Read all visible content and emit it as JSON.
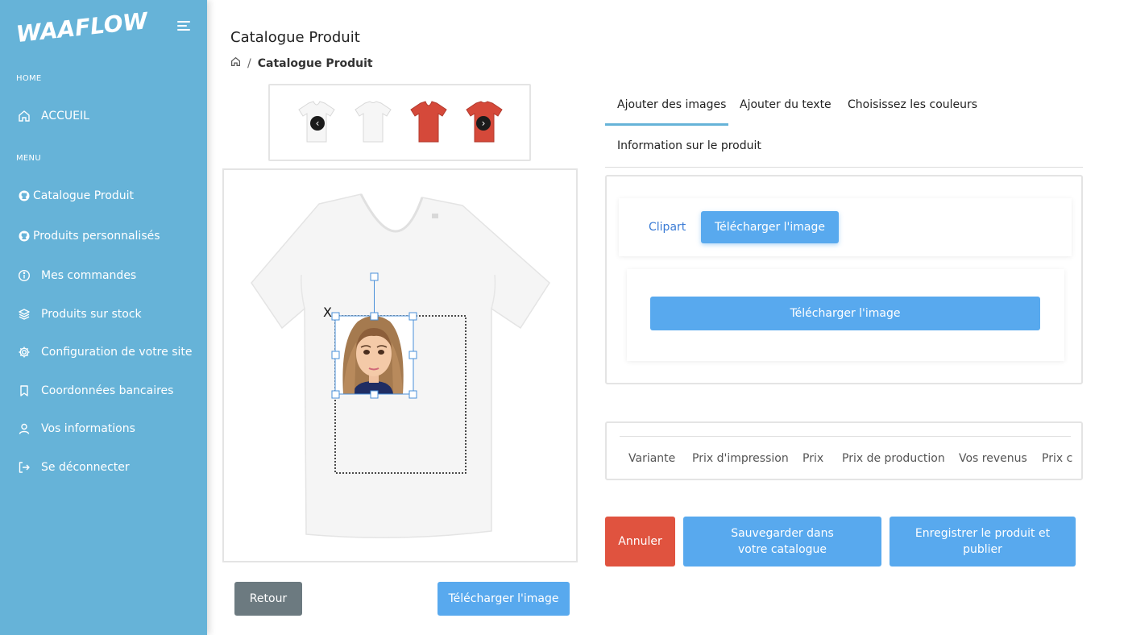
{
  "sidebar": {
    "logo_text": "WAAFLOW!",
    "home_section": "HOME",
    "menu_section": "MENU",
    "items": [
      {
        "label": "ACCUEIL",
        "icon": "home-icon"
      },
      {
        "label": "Catalogue Produit",
        "icon": "github-icon"
      },
      {
        "label": "Produits personnalisés",
        "icon": "github-icon"
      },
      {
        "label": "Mes commandes",
        "icon": "info-icon"
      },
      {
        "label": "Produits sur stock",
        "icon": "layers-icon"
      },
      {
        "label": "Configuration de votre site",
        "icon": "gear-icon"
      },
      {
        "label": "Coordonnées bancaires",
        "icon": "bookmark-icon"
      },
      {
        "label": "Vos informations",
        "icon": "user-icon"
      },
      {
        "label": "Se déconnecter",
        "icon": "logout-icon"
      }
    ]
  },
  "page": {
    "title": "Catalogue Produit",
    "breadcrumb_sep": "/",
    "breadcrumb_current": "Catalogue Produit"
  },
  "editor": {
    "delete_mark": "X",
    "back_label": "Retour",
    "upload_label": "Télécharger l'image"
  },
  "tabs": [
    {
      "label": "Ajouter des images",
      "active": true
    },
    {
      "label": "Ajouter du texte",
      "active": false
    },
    {
      "label": "Choisissez les couleurs",
      "active": false
    },
    {
      "label": "Information sur le produit",
      "active": false
    }
  ],
  "image_panel": {
    "clipart_label": "Clipart",
    "upload_tab_label": "Télécharger l'image",
    "upload_button_label": "Télécharger l'image"
  },
  "table": {
    "headers": [
      "Variante",
      "Prix d'impression",
      "Prix",
      "Prix de production",
      "Vos revenus",
      "Prix c"
    ]
  },
  "actions": {
    "cancel_label": "Annuler",
    "save_label": "Sauvegarder dans votre catalogue",
    "publish_label": "Enregistrer le produit et publier"
  },
  "colors": {
    "sidebar": "#66b3d8",
    "primary": "#58a9ee",
    "danger": "#e0533f",
    "secondary": "#6c7a80",
    "tshirt_red": "#d5493a"
  }
}
